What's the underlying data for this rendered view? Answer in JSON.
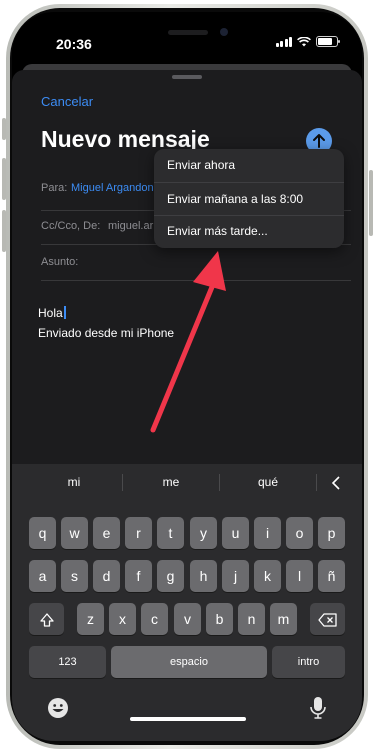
{
  "status_bar": {
    "time": "20:36"
  },
  "compose": {
    "cancel_label": "Cancelar",
    "title": "Nuevo mensaje",
    "to_label": "Para:",
    "to_value": "Miguel Argandona",
    "cc_label": "Cc/Cco, De:",
    "cc_value": "miguel.ar",
    "subject_label": "Asunto:",
    "body_line1": "Hola",
    "body_line2": "Enviado desde mi iPhone"
  },
  "send_menu": {
    "items": [
      {
        "label": "Enviar ahora"
      },
      {
        "label": "Enviar mañana a las 8:00"
      },
      {
        "label": "Enviar más tarde..."
      }
    ]
  },
  "keyboard": {
    "suggestions": [
      "mi",
      "me",
      "qué"
    ],
    "row1": [
      "q",
      "w",
      "e",
      "r",
      "t",
      "y",
      "u",
      "i",
      "o",
      "p"
    ],
    "row2": [
      "a",
      "s",
      "d",
      "f",
      "g",
      "h",
      "j",
      "k",
      "l",
      "ñ"
    ],
    "row3": [
      "z",
      "x",
      "c",
      "v",
      "b",
      "n",
      "m"
    ],
    "numbers_label": "123",
    "space_label": "espacio",
    "return_label": "intro"
  },
  "colors": {
    "accent": "#3C8CF4",
    "annotation_arrow": "#F0364A"
  }
}
